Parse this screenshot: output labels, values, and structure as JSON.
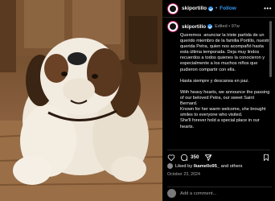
{
  "post": {
    "username": "skiportillo",
    "follow_label": "Follow",
    "more_label": "•••",
    "separator": "•",
    "edited_label": "Edited",
    "age": "97w",
    "caption": "Queremos  anunciar la triste partida de un querido miembro de la familia Portillo, nuestra querida Petra, quien nos acompañó hasta esta última temporada. Deja muy lindos recuerdos a todos quienes la conocieron y especialmente a los muchos niños que pudieron compartir con ella.\n\nHasta siempre y descansa en paz.\n\nWith heavy hearts, we announce the passing of our beloved Petra, our sweet Saint Bernard.\nKnown for her warm welcome, she brought smiles to everyone who visited.\nShe'll forever hold a special place in our hearts.",
    "likes_count": "350",
    "liked_by_prefix": "Liked by",
    "liked_by_user": "lkamello95_",
    "liked_by_suffix": "and others",
    "date": "October 23, 2024",
    "comment_placeholder": "Add a comment..."
  },
  "icons": {
    "heart": "heart-icon",
    "comment": "comment-icon",
    "share": "share-icon",
    "bookmark": "bookmark-icon"
  },
  "colors": {
    "background": "#000000",
    "link_blue": "#3797f0",
    "muted_text": "#a8a8a8"
  }
}
